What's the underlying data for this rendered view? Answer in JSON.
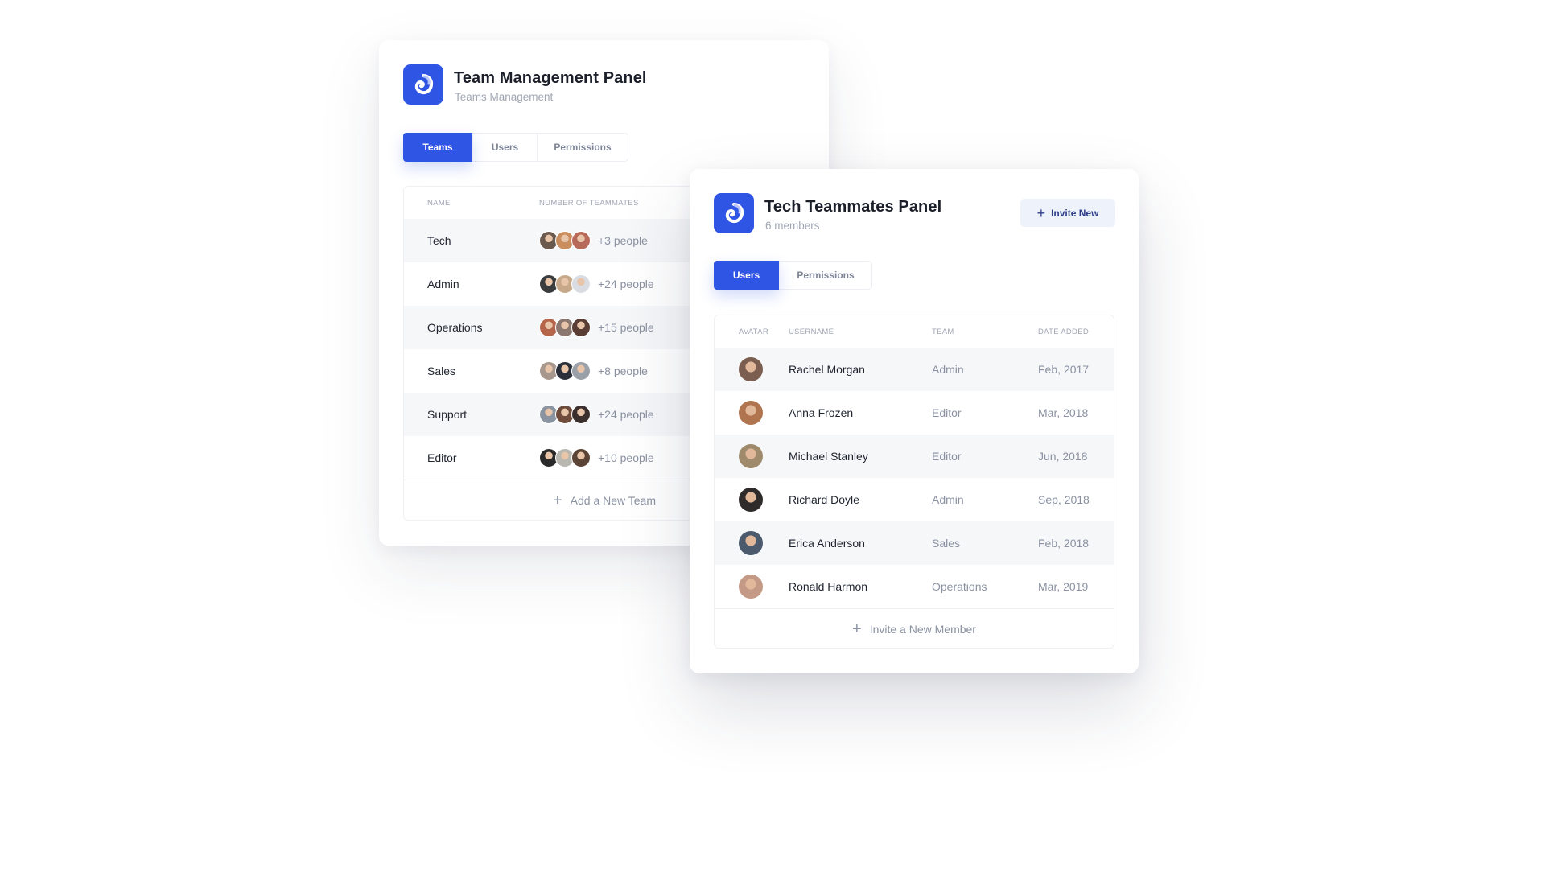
{
  "colors": {
    "accent": "#2f55e4",
    "button_bg": "#eef2fb",
    "button_text": "#2d3e86"
  },
  "teams_panel": {
    "logo_icon": "swirl-logo-icon",
    "title": "Team Management Panel",
    "subtitle": "Teams Management",
    "tabs": [
      {
        "label": "Teams",
        "active": true
      },
      {
        "label": "Users",
        "active": false
      },
      {
        "label": "Permissions",
        "active": false
      }
    ],
    "table": {
      "headers": {
        "name": "NAME",
        "teammates": "NUMBER OF TEAMMATES"
      },
      "rows": [
        {
          "name": "Tech",
          "count": "+3 people",
          "avatars": [
            "#6d5a4e",
            "#c98d5e",
            "#b86a5a"
          ]
        },
        {
          "name": "Admin",
          "count": "+24 people",
          "avatars": [
            "#3b3c3e",
            "#c7a98a",
            "#d9dde3"
          ]
        },
        {
          "name": "Operations",
          "count": "+15 people",
          "avatars": [
            "#b4654a",
            "#8a7870",
            "#5a3e36"
          ]
        },
        {
          "name": "Sales",
          "count": "+8 people",
          "avatars": [
            "#a8978c",
            "#2b2f3a",
            "#9aa0a8"
          ]
        },
        {
          "name": "Support",
          "count": "+24 people",
          "avatars": [
            "#8a94a0",
            "#6f4b3c",
            "#3a2f2c"
          ]
        },
        {
          "name": "Editor",
          "count": "+10 people",
          "avatars": [
            "#2a2a2a",
            "#b8b7b0",
            "#5b4436"
          ]
        }
      ],
      "add_label": "Add a New Team"
    }
  },
  "members_panel": {
    "logo_icon": "swirl-logo-icon",
    "title": "Tech Teammates Panel",
    "subtitle": "6 members",
    "invite_button": "Invite New",
    "tabs": [
      {
        "label": "Users",
        "active": true
      },
      {
        "label": "Permissions",
        "active": false
      }
    ],
    "table": {
      "headers": {
        "avatar": "AVATAR",
        "username": "USERNAME",
        "team": "TEAM",
        "date": "DATE ADDED"
      },
      "rows": [
        {
          "username": "Rachel Morgan",
          "team": "Admin",
          "date": "Feb, 2017",
          "avatar": "#7b5e50"
        },
        {
          "username": "Anna Frozen",
          "team": "Editor",
          "date": "Mar, 2018",
          "avatar": "#b0754e"
        },
        {
          "username": "Michael Stanley",
          "team": "Editor",
          "date": "Jun, 2018",
          "avatar": "#a08a6c"
        },
        {
          "username": "Richard Doyle",
          "team": "Admin",
          "date": "Sep, 2018",
          "avatar": "#2e2b2a"
        },
        {
          "username": "Erica Anderson",
          "team": "Sales",
          "date": "Feb, 2018",
          "avatar": "#4c5a6e"
        },
        {
          "username": "Ronald Harmon",
          "team": "Operations",
          "date": "Mar, 2019",
          "avatar": "#c49a86"
        }
      ],
      "add_label": "Invite a New Member"
    }
  }
}
